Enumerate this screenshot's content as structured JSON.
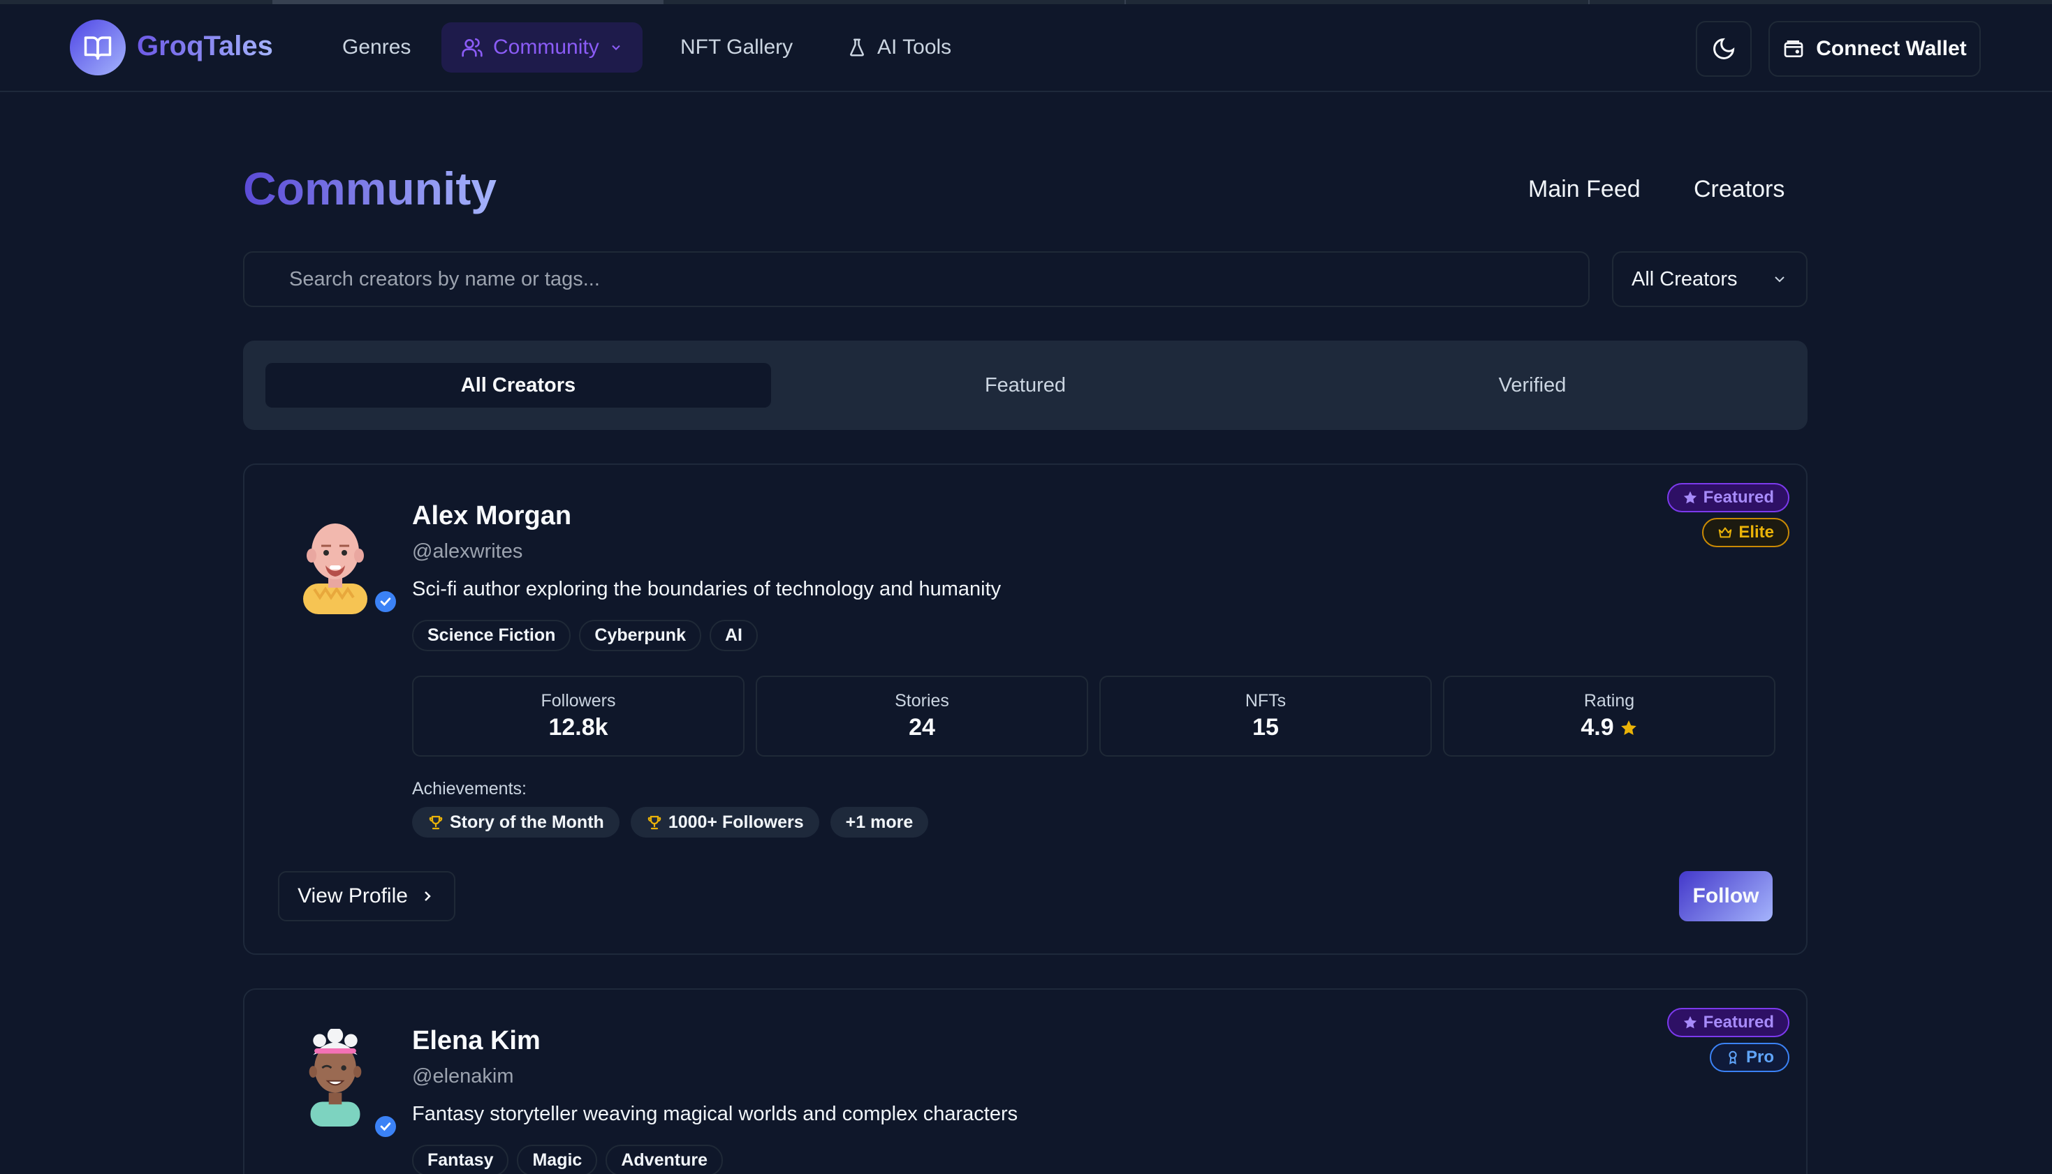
{
  "nav": {
    "brand": "GroqTales",
    "items": [
      {
        "label": "Genres",
        "icon": null
      },
      {
        "label": "Community",
        "icon": "users-icon",
        "active": true,
        "dropdown": true
      },
      {
        "label": "NFT Gallery",
        "icon": null
      },
      {
        "label": "AI Tools",
        "icon": "flask-icon"
      }
    ],
    "theme_toggle_icon": "moon-icon",
    "wallet_label": "Connect Wallet"
  },
  "header": {
    "title": "Community",
    "links": [
      "Main Feed",
      "Creators"
    ]
  },
  "search": {
    "placeholder": "Search creators by name or tags...",
    "filter_value": "All Creators"
  },
  "tabs": [
    {
      "label": "All Creators",
      "active": true
    },
    {
      "label": "Featured",
      "active": false
    },
    {
      "label": "Verified",
      "active": false
    }
  ],
  "creators": [
    {
      "name": "Alex Morgan",
      "handle": "@alexwrites",
      "bio": "Sci-fi author exploring the boundaries of technology and humanity",
      "tags": [
        "Science Fiction",
        "Cyberpunk",
        "AI"
      ],
      "badges": [
        {
          "label": "Featured",
          "icon": "star-icon",
          "kind": "featured"
        },
        {
          "label": "Elite",
          "icon": "crown-icon",
          "kind": "elite"
        }
      ],
      "stats": [
        {
          "label": "Followers",
          "value": "12.8k"
        },
        {
          "label": "Stories",
          "value": "24"
        },
        {
          "label": "NFTs",
          "value": "15"
        },
        {
          "label": "Rating",
          "value": "4.9"
        }
      ],
      "achievements_label": "Achievements:",
      "achievements": [
        "Story of the Month",
        "1000+ Followers",
        "+1 more"
      ],
      "view_label": "View Profile",
      "follow_label": "Follow"
    },
    {
      "name": "Elena Kim",
      "handle": "@elenakim",
      "bio": "Fantasy storyteller weaving magical worlds and complex characters",
      "tags": [
        "Fantasy",
        "Magic",
        "Adventure"
      ],
      "badges": [
        {
          "label": "Featured",
          "icon": "star-icon",
          "kind": "featured"
        },
        {
          "label": "Pro",
          "icon": "award-icon",
          "kind": "pro"
        }
      ]
    }
  ],
  "colors": {
    "background": "#0f172a",
    "accent": "#8b5cf6",
    "brand_gradient_start": "#4f46e5",
    "brand_gradient_end": "#a5b4fc",
    "verified": "#3b82f6",
    "star": "#eab308"
  }
}
